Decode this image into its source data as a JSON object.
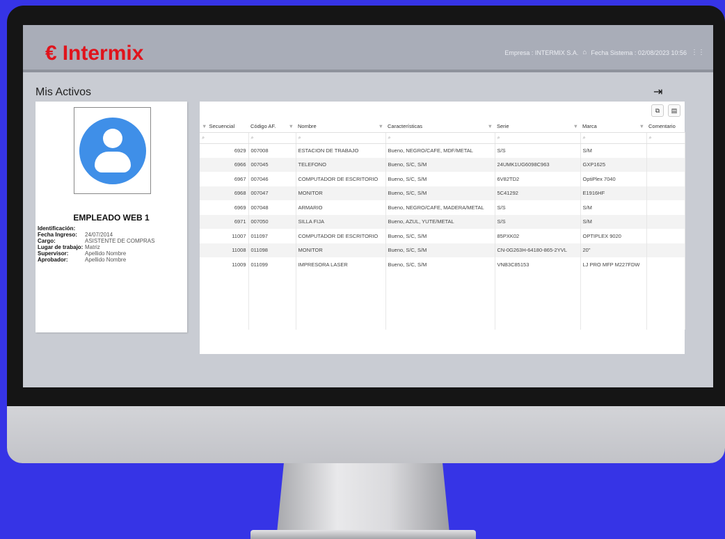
{
  "header": {
    "logo_text": "Intermix",
    "logo_symbol": "€",
    "empresa": "Empresa : INTERMIX S.A.",
    "fecha_sistema": "Fecha Sistema : 02/08/2023 10:56",
    "brand_color": "#e0141c"
  },
  "page": {
    "title": "Mis Activos"
  },
  "employee": {
    "name": "EMPLEADO WEB 1",
    "fields": [
      {
        "label": "Identificación:",
        "value": ""
      },
      {
        "label": "Fecha Ingreso:",
        "value": "24/07/2014"
      },
      {
        "label": "Cargo:",
        "value": "ASISTENTE DE COMPRAS"
      },
      {
        "label": "Lugar de trabajo:",
        "value": "Matriz"
      },
      {
        "label": "Supervisor:",
        "value": "Apellido Nombre"
      },
      {
        "label": "Aprobador:",
        "value": "Apellido Nombre"
      }
    ]
  },
  "grid": {
    "columns": [
      "Secuencial",
      "Código AF.",
      "Nombre",
      "Características",
      "Serie",
      "Marca",
      "Comentario"
    ],
    "rows": [
      [
        "6929",
        "007008",
        "ESTACION DE TRABAJO",
        "Bueno, NEGRO/CAFE, MDF/METAL",
        "S/S",
        "S/M",
        ""
      ],
      [
        "6966",
        "007045",
        "TELEFONO",
        "Bueno, S/C, S/M",
        "24UMK1UG6098C963",
        "GXP1625",
        ""
      ],
      [
        "6967",
        "007046",
        "COMPUTADOR DE ESCRITORIO",
        "Bueno, S/C, S/M",
        "6V82TD2",
        "OptiPlex 7040",
        ""
      ],
      [
        "6968",
        "007047",
        "MONITOR",
        "Bueno, S/C, S/M",
        "5C41292",
        "E1916HF",
        ""
      ],
      [
        "6969",
        "007048",
        "ARMARIO",
        "Bueno, NEGRO/CAFE, MADERA/METAL",
        "S/S",
        "S/M",
        ""
      ],
      [
        "6971",
        "007050",
        "SILLA FIJA",
        "Bueno, AZUL, YUTE/METAL",
        "S/S",
        "S/M",
        ""
      ],
      [
        "11007",
        "011097",
        "COMPUTADOR DE ESCRITORIO",
        "Bueno, S/C, S/M",
        "85PXK02",
        "OPTIPLEX 9020",
        ""
      ],
      [
        "11008",
        "011098",
        "MONITOR",
        "Bueno, S/C, S/M",
        "CN-0G263H-64180-865-2YVL",
        "20\"",
        ""
      ],
      [
        "11009",
        "011099",
        "IMPRESORA LASER",
        "Bueno, S/C, S/M",
        "VNB3C85153",
        "LJ PRO MFP M227FDW",
        ""
      ]
    ]
  },
  "icons": {
    "exit": "exit-icon",
    "copy": "copy-icon",
    "export": "export-icon",
    "filter": "filter-icon",
    "search": "search-icon"
  }
}
